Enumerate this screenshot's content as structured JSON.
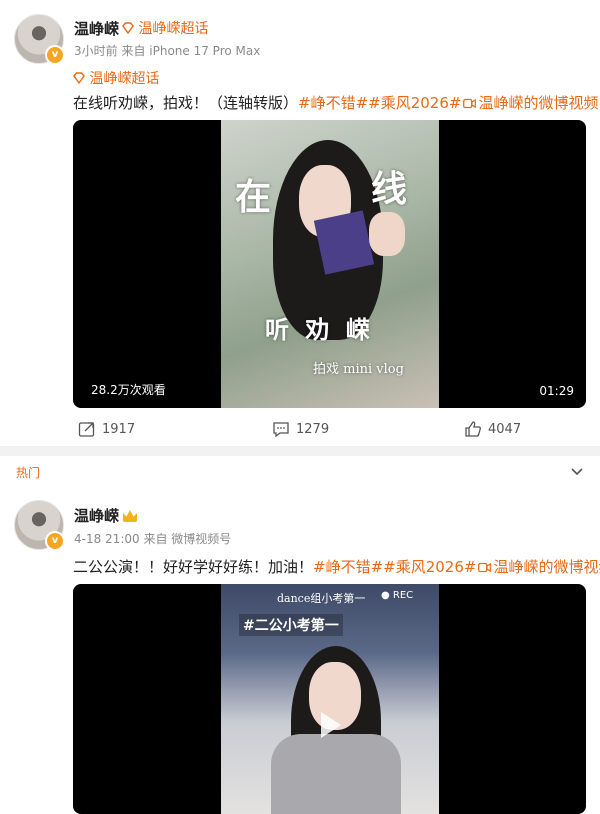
{
  "post1": {
    "username": "温峥嵘",
    "super_topic": "温峥嵘超话",
    "meta": "3小时前  来自 iPhone 17 Pro Max",
    "super_topic_line": "温峥嵘超话",
    "text_plain": "在线听劝嵘，拍戏！（连轴转版）",
    "tags": [
      "#峥不错#",
      "#乘风2026#"
    ],
    "video_link": "温峥嵘的微博视频",
    "video": {
      "overlay_big1": "在",
      "overlay_big2": "线",
      "overlay_mid": "听 劝 嵘",
      "overlay_small": "拍戏 mini vlog",
      "views": "28.2万次观看",
      "duration": "01:29"
    },
    "actions": {
      "repost": "1917",
      "comment": "1279",
      "like": "4047"
    }
  },
  "section": {
    "hot_label": "热门"
  },
  "post2": {
    "username": "温峥嵘",
    "meta": "4-18 21:00  来自 微博视频号",
    "text_plain": "二公公演！！好好学好好练！加油！",
    "tags": [
      "#峥不错#",
      "#乘风2026#"
    ],
    "video_link": "温峥嵘的微博视频",
    "video": {
      "overlay_top": "dance组小考第一",
      "overlay_tag": "#二公小考第一",
      "overlay_rec": "REC"
    }
  },
  "colors": {
    "accent": "#e86a17",
    "text": "#222222",
    "muted": "#8a8a8a"
  }
}
